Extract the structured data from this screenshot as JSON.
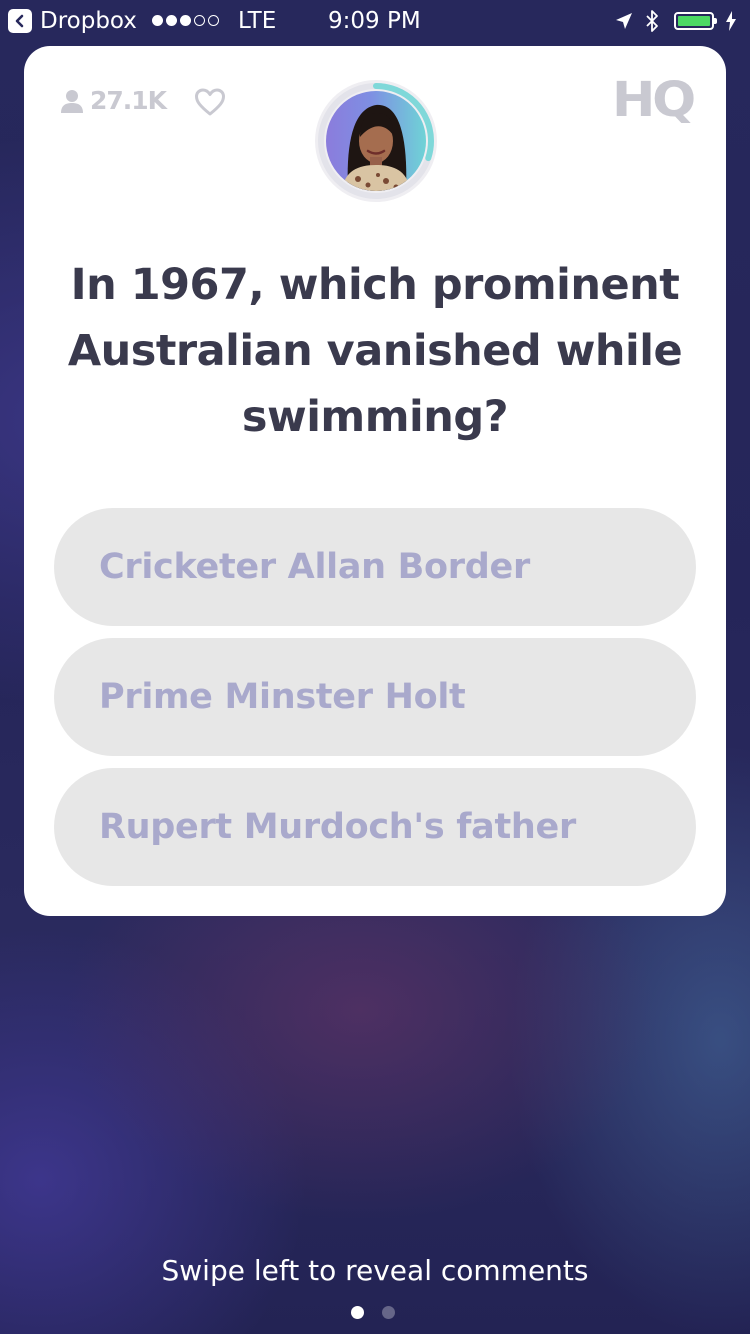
{
  "status_bar": {
    "back_app": "Dropbox",
    "signal_filled": 3,
    "signal_total": 5,
    "network": "LTE",
    "time": "9:09 PM",
    "battery_color": "#4cd964",
    "battery_level": 1.0
  },
  "card": {
    "viewer_count": "27.1K",
    "viewer_icon": "person-icon",
    "like_icon": "heart-icon",
    "logo": "HQ",
    "timer_fraction": 0.3,
    "timer_color": "#7fd8d9",
    "question": "In 1967, which prominent Australian vanished while swimming?",
    "answers": [
      "Cricketer Allan Border",
      "Prime Minster Holt",
      "Rupert Murdoch's father"
    ]
  },
  "footer": {
    "hint": "Swipe left to reveal comments",
    "page_count": 2,
    "active_page": 1
  },
  "colors": {
    "card_bg": "#ffffff",
    "question_text": "#3a3a4d",
    "answer_bg": "#e7e7e7",
    "answer_text": "#a9a9cc",
    "muted_icon": "#c9c9d1"
  }
}
